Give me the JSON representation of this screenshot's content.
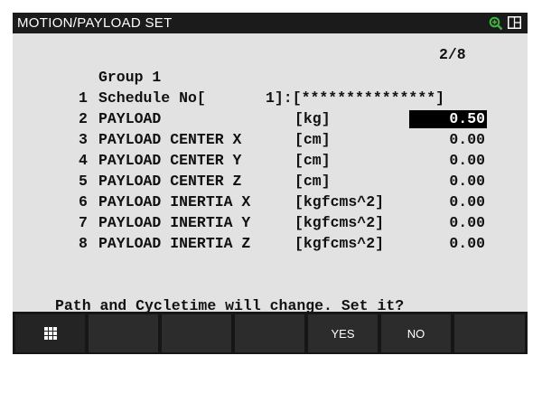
{
  "window": {
    "title": "MOTION/PAYLOAD SET",
    "icons": [
      "zoom-icon",
      "layout-icon"
    ]
  },
  "page": {
    "indicator": "2/8"
  },
  "group": {
    "label": "Group 1"
  },
  "rows": [
    {
      "num": "1",
      "label": "Schedule No[",
      "value": "1]:[***************]"
    },
    {
      "num": "2",
      "label": "PAYLOAD",
      "unit": "[kg]",
      "value": "0.50",
      "selected": true
    },
    {
      "num": "3",
      "label": "PAYLOAD CENTER X",
      "unit": "[cm]",
      "value": "0.00"
    },
    {
      "num": "4",
      "label": "PAYLOAD CENTER Y",
      "unit": "[cm]",
      "value": "0.00"
    },
    {
      "num": "5",
      "label": "PAYLOAD CENTER Z",
      "unit": "[cm]",
      "value": "0.00"
    },
    {
      "num": "6",
      "label": "PAYLOAD INERTIA X",
      "unit": "[kgfcms^2]",
      "value": "0.00"
    },
    {
      "num": "7",
      "label": "PAYLOAD INERTIA Y",
      "unit": "[kgfcms^2]",
      "value": "0.00"
    },
    {
      "num": "8",
      "label": "PAYLOAD INERTIA Z",
      "unit": "[kgfcms^2]",
      "value": "0.00"
    }
  ],
  "prompt": "Path and Cycletime will change. Set it?",
  "softkeys": [
    {
      "label": "",
      "icon": "grid-menu-icon"
    },
    {
      "label": ""
    },
    {
      "label": ""
    },
    {
      "label": ""
    },
    {
      "label": "YES"
    },
    {
      "label": "NO"
    },
    {
      "label": ""
    }
  ],
  "colors": {
    "screen_bg": "#e2e2e2",
    "frame": "#161616",
    "softkey": "#2c2c2c",
    "highlight": "#000000",
    "zoom_icon": "#3fb53f"
  }
}
